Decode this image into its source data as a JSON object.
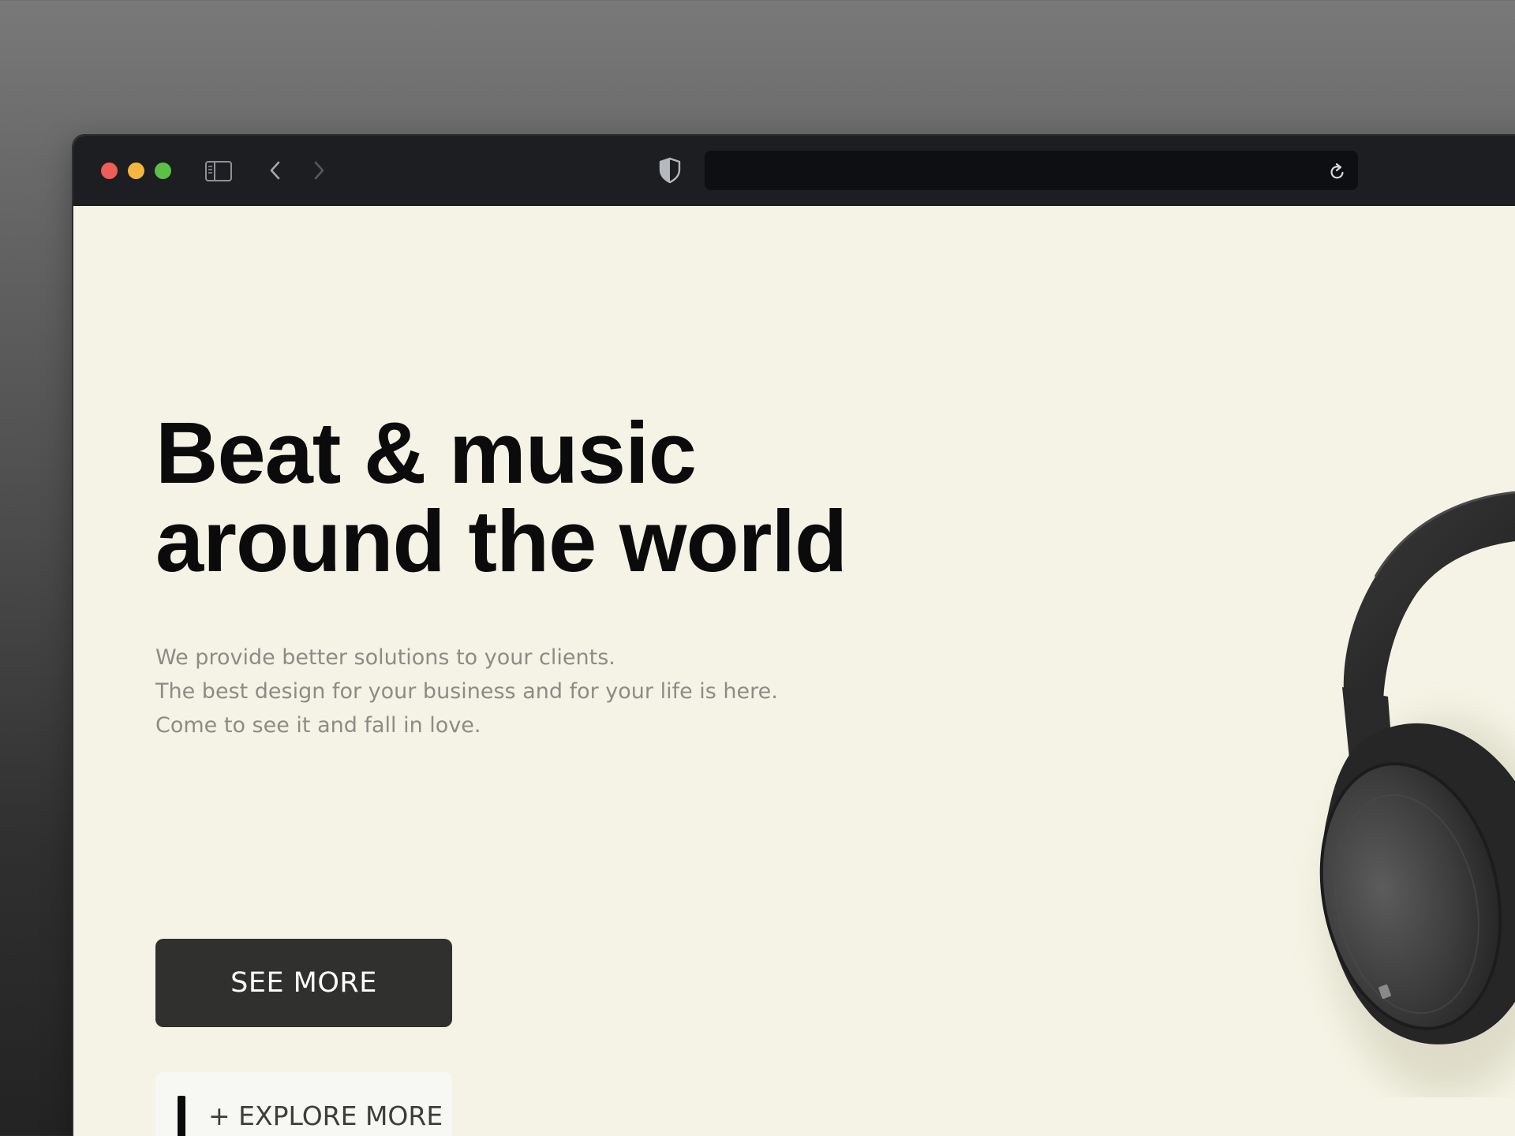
{
  "browser": {
    "url": "",
    "icons": {
      "sidebar": "sidebar-toggle-icon",
      "back": "chevron-left-icon",
      "forward": "chevron-right-icon",
      "privacy": "shield-icon",
      "reload": "reload-icon"
    },
    "traffic_lights": [
      "#ee5e57",
      "#f4b63e",
      "#5cbf46"
    ]
  },
  "hero": {
    "headline_line1": "Beat & music",
    "headline_line2": "around the world",
    "subtext_line1": "We provide better solutions to your clients.",
    "subtext_line2": "The best design for your business and for your life is here.",
    "subtext_line3": "Come to see it and fall in love.",
    "primary_button": "SEE MORE",
    "secondary_button": "+ EXPLORE MORE",
    "image": "headphones-image"
  },
  "colors": {
    "page_background": "#f4f3e5",
    "primary_button": "#30302e",
    "toolbar": "#1c1e21"
  }
}
